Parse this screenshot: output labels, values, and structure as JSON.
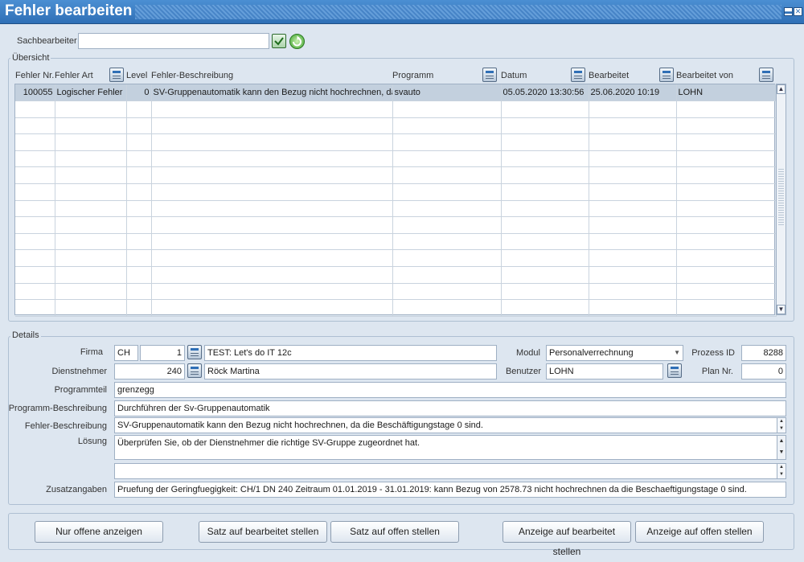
{
  "window": {
    "title": "Fehler bearbeiten"
  },
  "filter": {
    "label": "Sachbearbeiter",
    "value": ""
  },
  "overview": {
    "legend": "Übersicht",
    "columns": [
      "Fehler Nr.",
      "Fehler Art",
      "Level",
      "Fehler-Beschreibung",
      "Programm",
      "Datum",
      "Bearbeitet",
      "Bearbeitet von"
    ],
    "rows": [
      [
        "100055",
        "Logischer Fehler",
        "0",
        "SV-Gruppenautomatik kann den Bezug nicht hochrechnen, da",
        "svauto",
        "05.05.2020 13:30:56",
        "25.06.2020 10:19",
        "LOHN"
      ]
    ]
  },
  "details": {
    "legend": "Details",
    "firma_label": "Firma",
    "firma_code": "CH",
    "firma_nr": "1",
    "firma_name": "TEST: Let's do IT 12c",
    "modul_label": "Modul",
    "modul_value": "Personalverrechnung",
    "prozess_label": "Prozess ID",
    "prozess_value": "8288",
    "dn_label": "Dienstnehmer",
    "dn_nr": "240",
    "dn_name": "Röck Martina",
    "benutzer_label": "Benutzer",
    "benutzer_value": "LOHN",
    "plan_label": "Plan Nr.",
    "plan_value": "0",
    "programmteil_label": "Programmteil",
    "programmteil_value": "grenzegg",
    "progbeschr_label": "Programm-Beschreibung",
    "progbeschr_value": "Durchführen der Sv-Gruppenautomatik",
    "fehlerbeschr_label": "Fehler-Beschreibung",
    "fehlerbeschr_value": "SV-Gruppenautomatik kann den Bezug nicht hochrechnen, da die Beschäftigungstage 0 sind.",
    "loesung_label": "Lösung",
    "loesung_value": "Überprüfen Sie, ob der Dienstnehmer die richtige SV-Gruppe zugeordnet hat.",
    "extra_value": "",
    "zusatz_label": "Zusatzangaben",
    "zusatz_value": "Pruefung der Geringfuegigkeit: CH/1 DN 240 Zeitraum 01.01.2019 - 31.01.2019: kann Bezug von 2578.73 nicht hochrechnen da die Beschaeftigungstage 0 sind."
  },
  "buttons": {
    "nur_offene": "Nur offene anzeigen",
    "satz_bearbeitet": "Satz auf bearbeitet stellen",
    "satz_offen": "Satz auf offen stellen",
    "anzeige_bearbeitet": "Anzeige auf bearbeitet stellen",
    "anzeige_offen": "Anzeige auf offen stellen"
  }
}
